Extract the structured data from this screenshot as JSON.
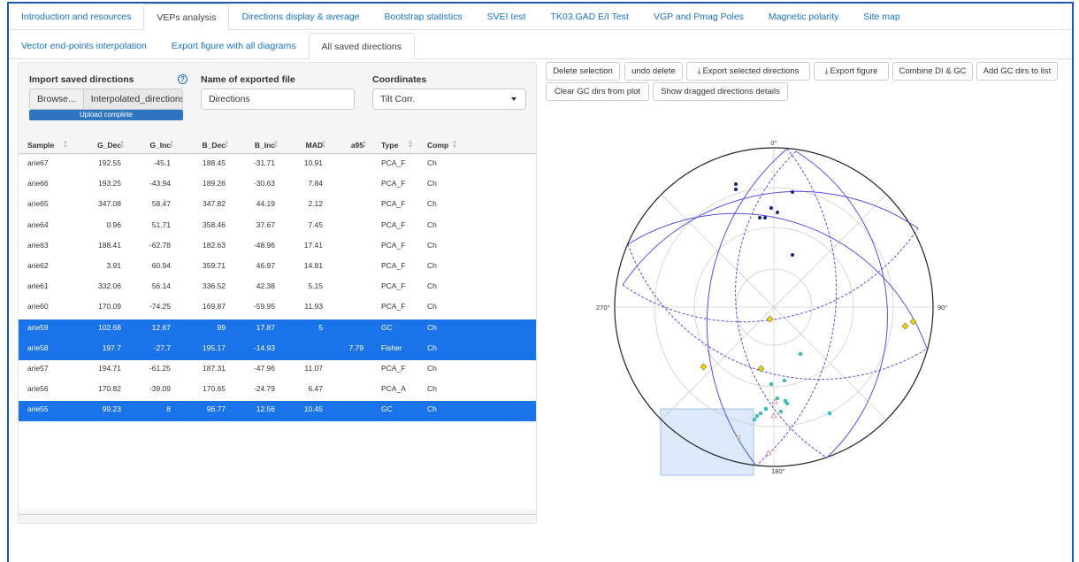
{
  "main_tabs": [
    {
      "label": "Introduction and resources",
      "active": false
    },
    {
      "label": "VEPs analysis",
      "active": true
    },
    {
      "label": "Directions display & average",
      "active": false
    },
    {
      "label": "Bootstrap statistics",
      "active": false
    },
    {
      "label": "SVEI test",
      "active": false
    },
    {
      "label": "TK03.GAD E/I Test",
      "active": false
    },
    {
      "label": "VGP and Pmag Poles",
      "active": false
    },
    {
      "label": "Magnetic polarity",
      "active": false
    },
    {
      "label": "Site map",
      "active": false
    }
  ],
  "sub_tabs": [
    {
      "label": "Vector end-points interpolation",
      "active": false
    },
    {
      "label": "Export figure with all diagrams",
      "active": false
    },
    {
      "label": "All saved directions",
      "active": true
    }
  ],
  "import": {
    "label": "Import saved directions",
    "browse": "Browse...",
    "filename": "Interpolated_directions_",
    "status": "Upload complete"
  },
  "export_name": {
    "label": "Name of exported file",
    "value": "Directions"
  },
  "coordinates": {
    "label": "Coordinates",
    "value": "Tilt Corr."
  },
  "table": {
    "columns": [
      "Sample",
      "G_Dec",
      "G_Inc",
      "B_Dec",
      "B_Inc",
      "MAD",
      "a95",
      "Type",
      "Comp"
    ],
    "rows": [
      {
        "cells": [
          "arie67",
          "192.55",
          "-45.1",
          "188.45",
          "-31.71",
          "10.91",
          "",
          "PCA_F",
          "Ch"
        ],
        "selected": false
      },
      {
        "cells": [
          "arie66",
          "193.25",
          "-43.94",
          "189.26",
          "-30.63",
          "7.84",
          "",
          "PCA_F",
          "Ch"
        ],
        "selected": false
      },
      {
        "cells": [
          "arie65",
          "347.08",
          "58.47",
          "347.82",
          "44.19",
          "2.12",
          "",
          "PCA_F",
          "Ch"
        ],
        "selected": false
      },
      {
        "cells": [
          "arie64",
          "0.96",
          "51.71",
          "358.46",
          "37.67",
          "7.45",
          "",
          "PCA_F",
          "Ch"
        ],
        "selected": false
      },
      {
        "cells": [
          "arie63",
          "188.41",
          "-62.78",
          "182.63",
          "-48.96",
          "17.41",
          "",
          "PCA_F",
          "Ch"
        ],
        "selected": false
      },
      {
        "cells": [
          "arie62",
          "3.91",
          "60.94",
          "359.71",
          "46.97",
          "14.81",
          "",
          "PCA_F",
          "Ch"
        ],
        "selected": false
      },
      {
        "cells": [
          "arie61",
          "332.06",
          "56.14",
          "336.52",
          "42.38",
          "5.15",
          "",
          "PCA_F",
          "Ch"
        ],
        "selected": false
      },
      {
        "cells": [
          "arie60",
          "170.09",
          "-74.25",
          "169.87",
          "-59.95",
          "11.93",
          "",
          "PCA_F",
          "Ch"
        ],
        "selected": false
      },
      {
        "cells": [
          "arie59",
          "102.68",
          "12.67",
          "99",
          "17.87",
          "5",
          "",
          "GC",
          "Ch"
        ],
        "selected": true
      },
      {
        "cells": [
          "arie58",
          "197.7",
          "-27.7",
          "195.17",
          "-14.93",
          "",
          "7.79",
          "Fisher",
          "Ch"
        ],
        "selected": true
      },
      {
        "cells": [
          "arie57",
          "194.71",
          "-61.25",
          "187.31",
          "-47.96",
          "11.07",
          "",
          "PCA_F",
          "Ch"
        ],
        "selected": false
      },
      {
        "cells": [
          "arie56",
          "170.82",
          "-39.09",
          "170.65",
          "-24.79",
          "6.47",
          "",
          "PCA_A",
          "Ch"
        ],
        "selected": false
      },
      {
        "cells": [
          "arie55",
          "99.23",
          "8",
          "96.77",
          "12.56",
          "10.45",
          "",
          "GC",
          "Ch"
        ],
        "selected": true
      }
    ]
  },
  "buttons": {
    "delete_selection": "Delete selection",
    "undo_delete": "undo delete",
    "export_selected": "Export selected directions",
    "export_figure": "Export figure",
    "combine": "Combine DI & GC",
    "add_gc": "Add GC dirs to list",
    "clear_gc": "Clear GC dirs from plot",
    "show_dragged": "Show dragged directions details"
  },
  "plot": {
    "labels": {
      "north": "0°",
      "east": "90°",
      "south": "180°",
      "west": "270°"
    },
    "colors": {
      "down": "#1a237e",
      "fisher": "#f2d500",
      "pca_up": "#40c8c8",
      "gc": "#5050e0",
      "select_box": "#dbe9f8"
    }
  }
}
